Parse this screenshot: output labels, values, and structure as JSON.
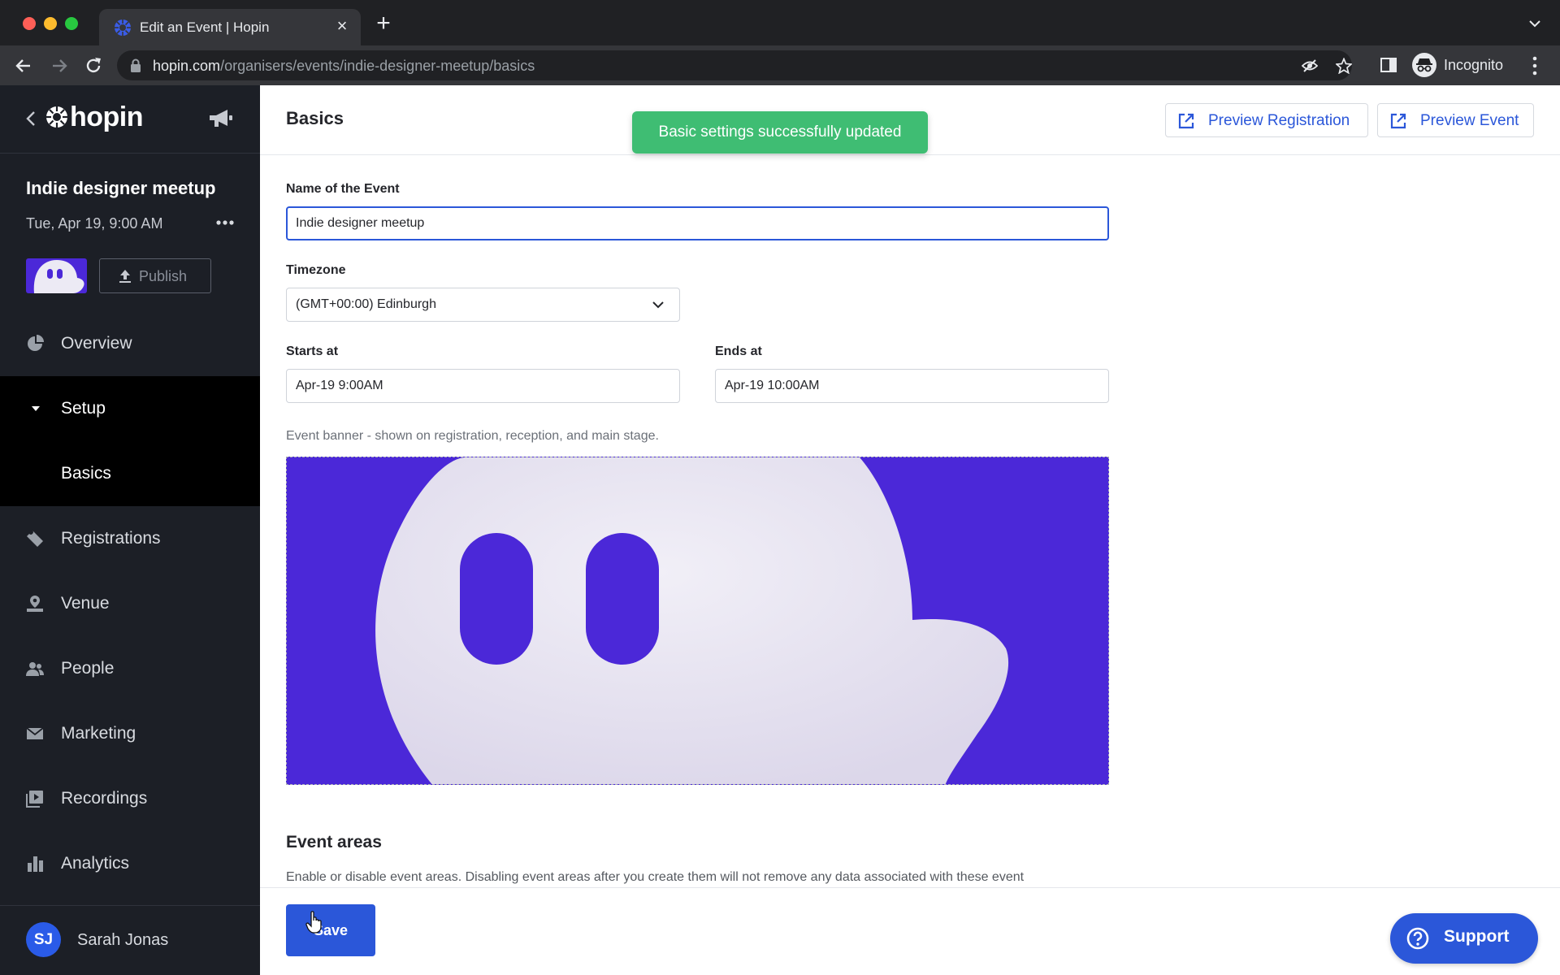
{
  "browser": {
    "tab_title": "Edit an Event | Hopin",
    "url_host": "hopin.com",
    "url_path": "/organisers/events/indie-designer-meetup/basics",
    "profile_label": "Incognito"
  },
  "sidebar": {
    "logo_text": "hopin",
    "event_name": "Indie designer meetup",
    "event_date": "Tue, Apr 19, 9:00 AM",
    "publish_label": "Publish",
    "nav": {
      "overview": "Overview",
      "setup": "Setup",
      "basics": "Basics",
      "registrations": "Registrations",
      "venue": "Venue",
      "people": "People",
      "marketing": "Marketing",
      "recordings": "Recordings",
      "analytics": "Analytics"
    },
    "user": {
      "initials": "SJ",
      "name": "Sarah Jonas"
    }
  },
  "main": {
    "title": "Basics",
    "toast": "Basic settings successfully updated",
    "preview_registration": "Preview Registration",
    "preview_event": "Preview Event",
    "form": {
      "name_label": "Name of the Event",
      "name_value": "Indie designer meetup",
      "timezone_label": "Timezone",
      "timezone_value": "(GMT+00:00) Edinburgh",
      "starts_label": "Starts at",
      "starts_value": "Apr-19 9:00AM",
      "ends_label": "Ends at",
      "ends_value": "Apr-19 10:00AM",
      "banner_hint": "Event banner - shown on registration, reception, and main stage."
    },
    "event_areas": {
      "title": "Event areas",
      "description": "Enable or disable event areas. Disabling event areas after you create them will not remove any data associated with these event"
    },
    "save_label": "Save",
    "support_label": "Support"
  },
  "colors": {
    "accent": "#2b57d9",
    "success": "#3fbd73",
    "sidebar_bg": "#1c1f26",
    "banner_purple": "#4b28d8"
  },
  "icons": [
    "back-arrow-icon",
    "forward-arrow-icon",
    "reload-icon",
    "lock-icon",
    "eye-off-icon",
    "star-icon",
    "sidepanel-icon",
    "incognito-icon",
    "kebab-icon",
    "hopin-logo-icon",
    "megaphone-icon",
    "more-dots-icon",
    "upload-icon",
    "pie-chart-icon",
    "caret-down-icon",
    "ticket-icon",
    "venue-icon",
    "people-icon",
    "mail-icon",
    "recordings-icon",
    "bar-chart-icon",
    "external-link-icon",
    "chevron-down-icon",
    "help-icon"
  ]
}
